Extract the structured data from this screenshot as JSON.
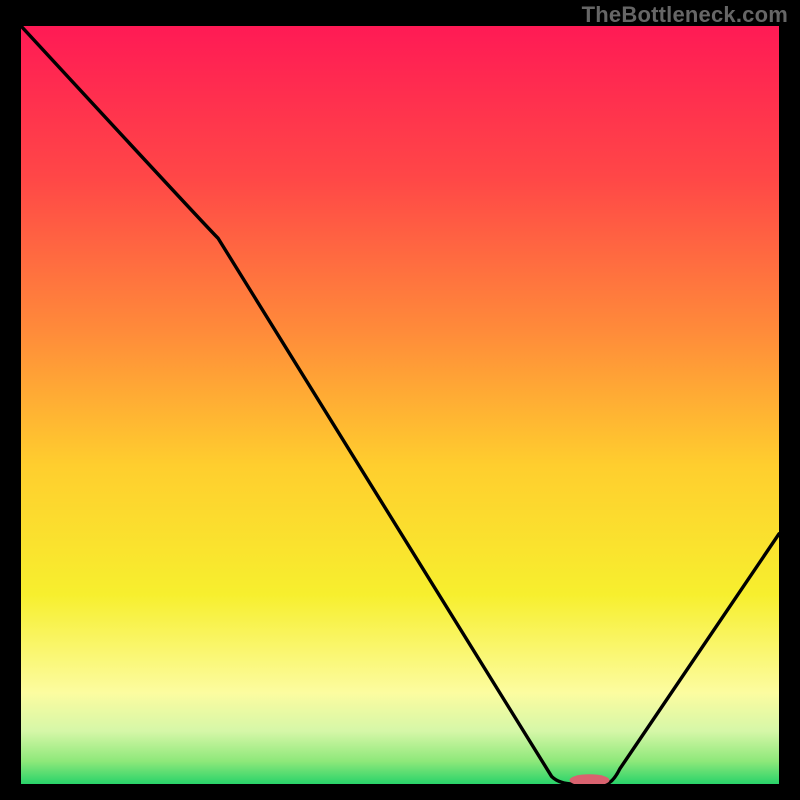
{
  "watermark": "TheBottleneck.com",
  "chart_data": {
    "type": "line",
    "title": "",
    "xlabel": "",
    "ylabel": "",
    "xlim": [
      0,
      100
    ],
    "ylim": [
      0,
      100
    ],
    "x": [
      0,
      26,
      70,
      73,
      77,
      100
    ],
    "values": [
      100,
      72,
      1,
      0,
      0,
      33
    ],
    "gradient_stops": [
      {
        "offset": 0.0,
        "color": "#ff1a55"
      },
      {
        "offset": 0.2,
        "color": "#ff4747"
      },
      {
        "offset": 0.4,
        "color": "#ff8a3a"
      },
      {
        "offset": 0.58,
        "color": "#ffce2e"
      },
      {
        "offset": 0.75,
        "color": "#f7ef2e"
      },
      {
        "offset": 0.88,
        "color": "#fcfca0"
      },
      {
        "offset": 0.93,
        "color": "#d6f7a8"
      },
      {
        "offset": 0.97,
        "color": "#8ee87a"
      },
      {
        "offset": 1.0,
        "color": "#29d36a"
      }
    ],
    "marker": {
      "x": 75,
      "y": 0.5,
      "color": "#d9626f",
      "rx": 20,
      "ry": 6
    }
  }
}
